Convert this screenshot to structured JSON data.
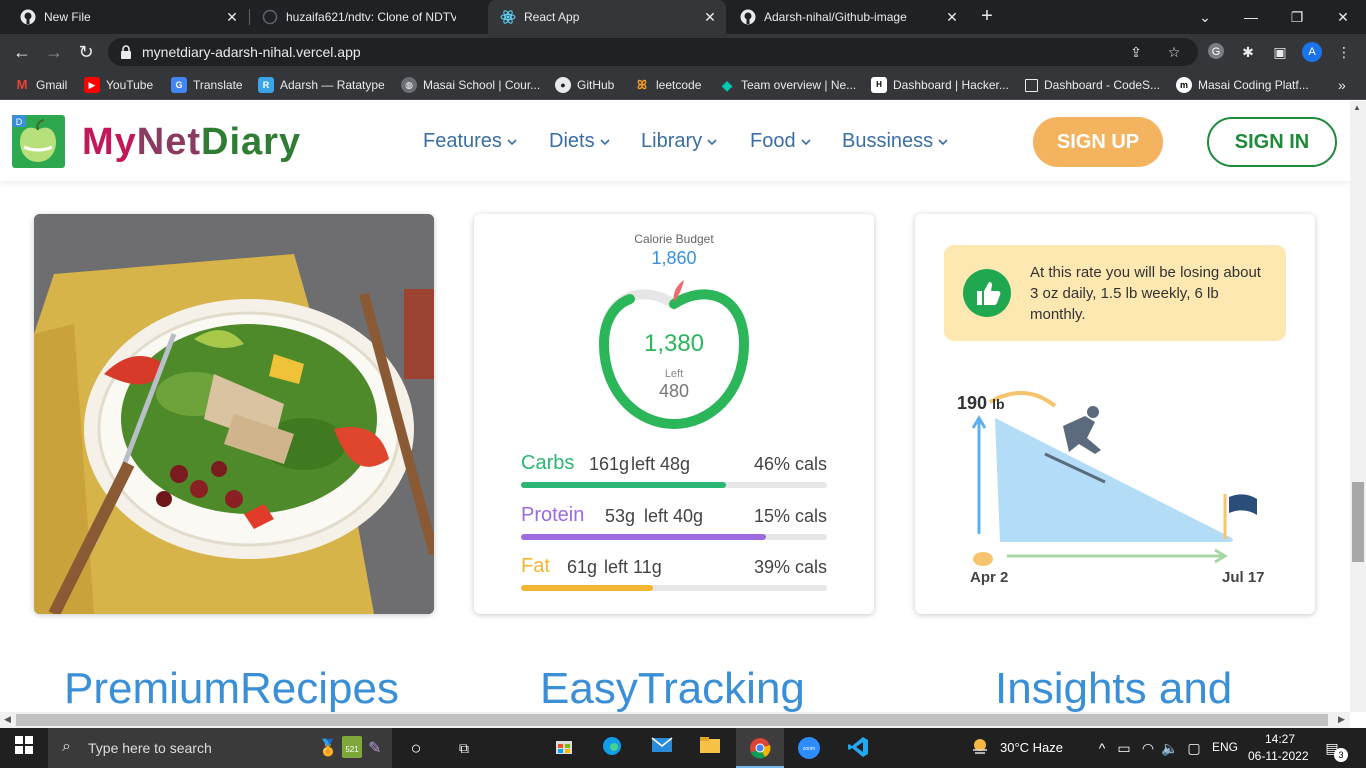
{
  "browser": {
    "tabs": [
      {
        "title": "New File",
        "active": false
      },
      {
        "title": "huzaifa621/ndtv: Clone of NDTV",
        "active": false
      },
      {
        "title": "React App",
        "active": true
      },
      {
        "title": "Adarsh-nihal/Github-image",
        "active": false
      }
    ],
    "url": "mynetdiary-adarsh-nihal.vercel.app",
    "profile_initial": "A",
    "bookmarks": [
      {
        "label": "Gmail"
      },
      {
        "label": "YouTube"
      },
      {
        "label": "Translate"
      },
      {
        "label": "Adarsh — Ratatype"
      },
      {
        "label": "Masai School | Cour..."
      },
      {
        "label": "GitHub"
      },
      {
        "label": "leetcode"
      },
      {
        "label": "Team overview | Ne..."
      },
      {
        "label": "Dashboard | Hacker..."
      },
      {
        "label": "Dashboard - CodeS..."
      },
      {
        "label": "Masai Coding Platf..."
      }
    ],
    "more_bookmarks": "»"
  },
  "site": {
    "logo": {
      "my": "My",
      "net": "Net",
      "diary": "Diary",
      "badge": "D"
    },
    "nav": [
      {
        "label": "Features"
      },
      {
        "label": "Diets"
      },
      {
        "label": "Library"
      },
      {
        "label": "Food"
      },
      {
        "label": "Bussiness"
      }
    ],
    "signup": "SIGN UP",
    "signin": "SIGN IN"
  },
  "calorie_card": {
    "label": "Calorie Budget",
    "budget": "1,860",
    "center_value": "1,380",
    "left_label": "Left",
    "left_value": "480",
    "macros": [
      {
        "name": "Carbs",
        "grams": "161g",
        "left": "left 48g",
        "cals": "46% cals",
        "color": "#2bb673",
        "fill": 0.67
      },
      {
        "name": "Protein",
        "grams": "53g",
        "left": "left 40g",
        "cals": "15% cals",
        "color": "#9b6bdf",
        "fill": 0.8
      },
      {
        "name": "Fat",
        "grams": "61g",
        "left": "left 11g",
        "cals": "39% cals",
        "color": "#f2b632",
        "fill": 0.43
      }
    ]
  },
  "insights_card": {
    "message": "At this rate you will be losing about 3 oz daily, 1.5 lb weekly, 6 lb monthly.",
    "start_weight": "190",
    "start_unit": "lb",
    "start_date": "Apr 2",
    "end_date": "Jul 17"
  },
  "headings": [
    "PremiumRecipes",
    "EasyTracking",
    "Insights and"
  ],
  "taskbar": {
    "search_placeholder": "Type here to search",
    "weather": "30°C  Haze",
    "language": "ENG",
    "time": "14:27",
    "date": "06-11-2022",
    "notifications": "3",
    "badge_count": "521"
  },
  "colors": {
    "brand_green": "#1f8a3a",
    "signup_orange": "#f4b35e",
    "link_blue": "#3a8fd6"
  }
}
